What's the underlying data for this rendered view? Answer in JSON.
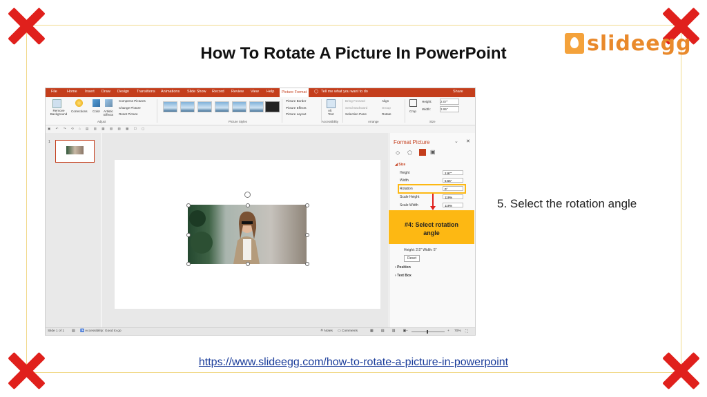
{
  "slide": {
    "title": "How To Rotate A Picture In PowerPoint",
    "logo_text": "slideegg",
    "step_text": "5. Select the rotation angle",
    "link_text": "https://www.slideegg.com/how-to-rotate-a-picture-in-powerpoint"
  },
  "colors": {
    "ppt_accent": "#c43e1c",
    "callout": "#fdb813",
    "xmark": "#e0201c",
    "logo": "#e9892b",
    "link": "#1a3c9a"
  },
  "ppt": {
    "menu": [
      "File",
      "Home",
      "Insert",
      "Draw",
      "Design",
      "Transitions",
      "Animations",
      "Slide Show",
      "Record",
      "Review",
      "View",
      "Help"
    ],
    "menu_active": "Picture Format",
    "tell_me": "Tell me what you want to do",
    "share": "Share",
    "ribbon": {
      "remove_bg": "Remove Background",
      "corrections": "Corrections",
      "color": "Color",
      "artistic": "Artistic Effects",
      "compress": "Compress Pictures",
      "change": "Change Picture",
      "reset": "Reset Picture",
      "adjust_group": "Adjust",
      "styles_group": "Picture Styles",
      "border": "Picture Border",
      "effects": "Picture Effects",
      "layout": "Picture Layout",
      "alt_text": "Alt Text",
      "accessibility_group": "Accessibility",
      "bring_forward": "Bring Forward",
      "send_backward": "Send Backward",
      "selection_pane": "Selection Pane",
      "align": "Align",
      "group": "Group",
      "rotate": "Rotate",
      "arrange_group": "Arrange",
      "crop": "Crop",
      "height_label": "Height:",
      "height_value": "2.07\"",
      "width_label": "Width:",
      "width_value": "3.95\"",
      "size_group": "Size"
    },
    "slide_number": "1",
    "pane": {
      "title": "Format Picture",
      "size_section": "Size",
      "height_label": "Height",
      "height_value": "2.97\"",
      "width_label": "Width",
      "width_value": "5.55\"",
      "rotation_label": "Rotation",
      "rotation_value": "0°",
      "scale_height_label": "Scale Height",
      "scale_height_value": "119%",
      "scale_width_label": "Scale Width",
      "scale_width_value": "119%",
      "callout_line1": "#4: Select rotation",
      "callout_line2": "angle",
      "original_size": "Height: 2.5\"   Width: 5\"",
      "reset": "Reset",
      "position": "Position",
      "text_box": "Text Box"
    },
    "status": {
      "slide": "Slide 1 of 1",
      "accessibility": "Accessibility: Good to go",
      "notes": "Notes",
      "comments": "Comments",
      "zoom": "70%"
    }
  }
}
